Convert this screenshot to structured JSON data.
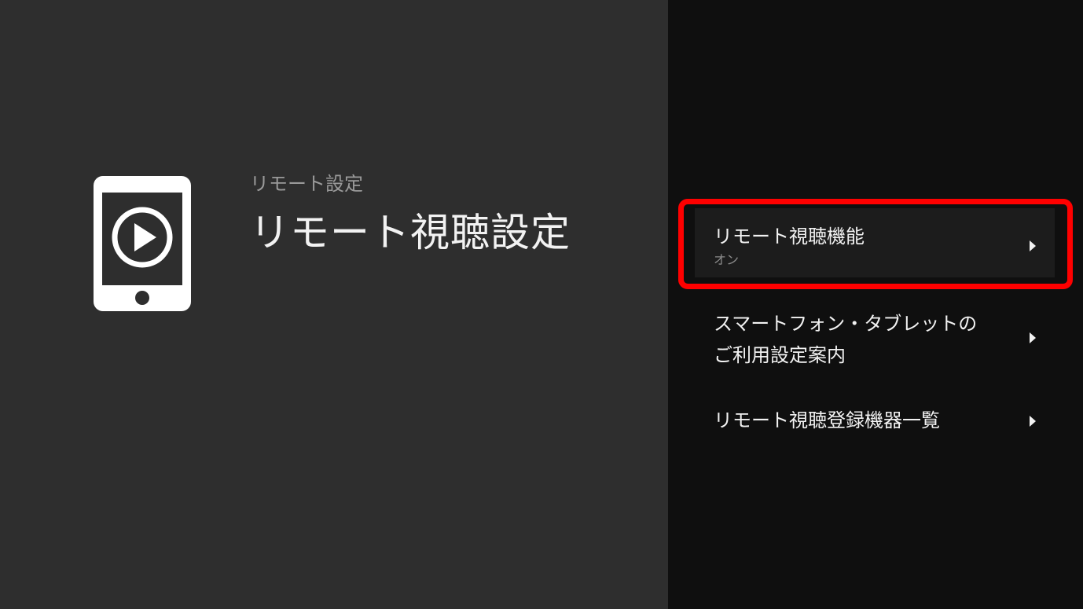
{
  "header": {
    "breadcrumb": "リモート設定",
    "title": "リモート視聴設定",
    "icon": "tablet-play-icon"
  },
  "menu": {
    "items": [
      {
        "label": "リモート視聴機能",
        "sub": "オン",
        "selected": true
      },
      {
        "label_line1": "スマートフォン・タブレットの",
        "label_line2": "ご利用設定案内"
      },
      {
        "label": "リモート視聴登録機器一覧"
      }
    ]
  },
  "colors": {
    "left_bg": "#2e2e2e",
    "right_bg": "#0f0f0f",
    "selected_bg": "#1c1c1c",
    "highlight": "#ff0000",
    "text": "#f2f2f2",
    "subtext": "#8c8c8c"
  }
}
